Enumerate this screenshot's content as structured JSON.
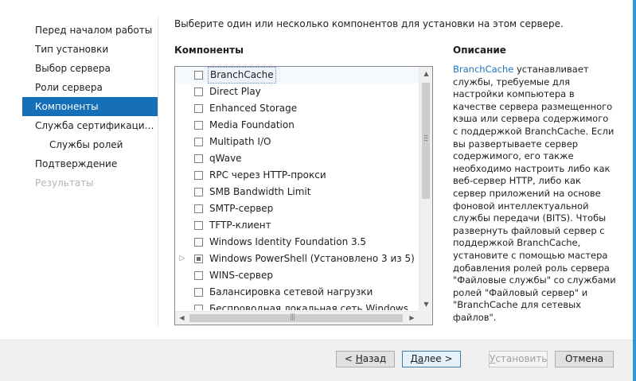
{
  "nav": {
    "items": [
      {
        "label": "Перед началом работы",
        "state": "normal"
      },
      {
        "label": "Тип установки",
        "state": "normal"
      },
      {
        "label": "Выбор сервера",
        "state": "normal"
      },
      {
        "label": "Роли сервера",
        "state": "normal"
      },
      {
        "label": "Компоненты",
        "state": "active"
      },
      {
        "label": "Служба сертификации А...",
        "state": "normal"
      },
      {
        "label": "Службы ролей",
        "state": "sub"
      },
      {
        "label": "Подтверждение",
        "state": "normal"
      },
      {
        "label": "Результаты",
        "state": "disabled"
      }
    ]
  },
  "main": {
    "intro": "Выберите один или несколько компонентов для установки на этом сервере.",
    "components_header": "Компоненты",
    "description_header": "Описание"
  },
  "features": [
    {
      "label": "BranchCache",
      "checked": "none",
      "expandable": false,
      "selected": true
    },
    {
      "label": "Direct Play",
      "checked": "none",
      "expandable": false
    },
    {
      "label": "Enhanced Storage",
      "checked": "none",
      "expandable": false
    },
    {
      "label": "Media Foundation",
      "checked": "none",
      "expandable": false
    },
    {
      "label": "Multipath I/O",
      "checked": "none",
      "expandable": false
    },
    {
      "label": "qWave",
      "checked": "none",
      "expandable": false
    },
    {
      "label": "RPC через HTTP-прокси",
      "checked": "none",
      "expandable": false
    },
    {
      "label": "SMB Bandwidth Limit",
      "checked": "none",
      "expandable": false
    },
    {
      "label": "SMTP-сервер",
      "checked": "none",
      "expandable": false
    },
    {
      "label": "TFTP-клиент",
      "checked": "none",
      "expandable": false
    },
    {
      "label": "Windows Identity Foundation 3.5",
      "checked": "none",
      "expandable": false
    },
    {
      "label": "Windows PowerShell (Установлено 3 из 5)",
      "checked": "partial",
      "expandable": true
    },
    {
      "label": "WINS-сервер",
      "checked": "none",
      "expandable": false
    },
    {
      "label": "Балансировка сетевой нагрузки",
      "checked": "none",
      "expandable": false
    },
    {
      "label": "Беспроводная локальная сеть Windows",
      "checked": "none",
      "expandable": false
    }
  ],
  "description": {
    "link": "BranchCache",
    "text": " устанавливает службы, требуемые для настройки компьютера в качестве сервера размещенного кэша или сервера содержимого с поддержкой BranchCache. Если вы развертываете сервер содержимого, его также необходимо настроить либо как веб-сервер HTTP, либо как сервер приложений на основе фоновой интеллектуальной службы передачи (BITS). Чтобы развернуть файловый сервер с поддержкой BranchCache, установите с помощью мастера добавления ролей роль сервера \"Файловые службы\" со службами ролей \"Файловый сервер\" и \"BranchCache для сетевых файлов\"."
  },
  "footer": {
    "back_pre": "< ",
    "back_key": "Н",
    "back_post": "азад",
    "next_pre": "Д",
    "next_key": "а",
    "next_post": "лее >",
    "install_key": "У",
    "install_post": "становить",
    "cancel": "Отмена"
  }
}
